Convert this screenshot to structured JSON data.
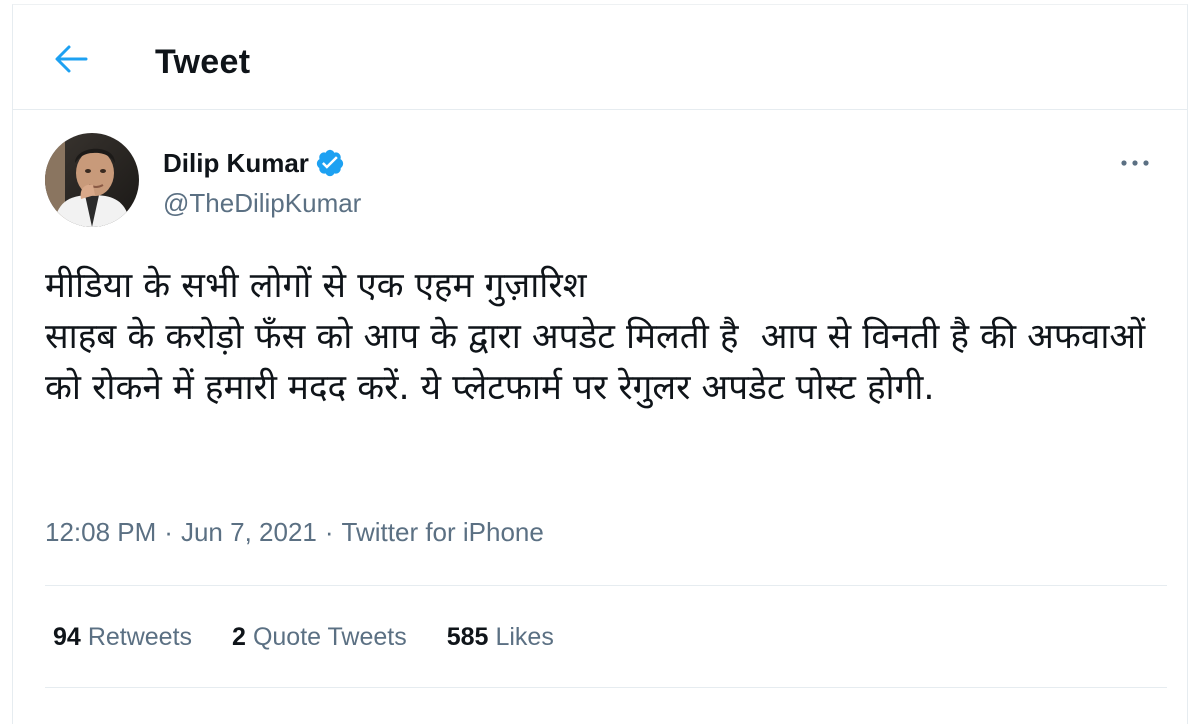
{
  "header": {
    "title": "Tweet",
    "back_icon": "arrow-left-icon"
  },
  "author": {
    "name": "Dilip Kumar",
    "handle": "@TheDilipKumar",
    "verified_icon": "verified-badge-icon"
  },
  "tweet": {
    "text": "मीडिया के सभी लोगों से एक एहम गुज़ारिश\nसाहब के करोड़ो फँस को आप के द्वारा अपडेट मिलती है  आप से विनती है की अफवाओं को रोकने में हमारी मदद करें. ये प्लेटफार्म पर रेगुलर अपडेट पोस्ट होगी.",
    "time": "12:08 PM",
    "date": "Jun 7, 2021",
    "separator": "·",
    "source": "Twitter for iPhone"
  },
  "stats": {
    "retweets_count": "94",
    "retweets_label": "Retweets",
    "quotes_count": "2",
    "quotes_label": "Quote Tweets",
    "likes_count": "585",
    "likes_label": "Likes"
  },
  "colors": {
    "accent": "#1da1f2",
    "secondary_text": "#5b7083",
    "border": "#e6ecf0"
  }
}
